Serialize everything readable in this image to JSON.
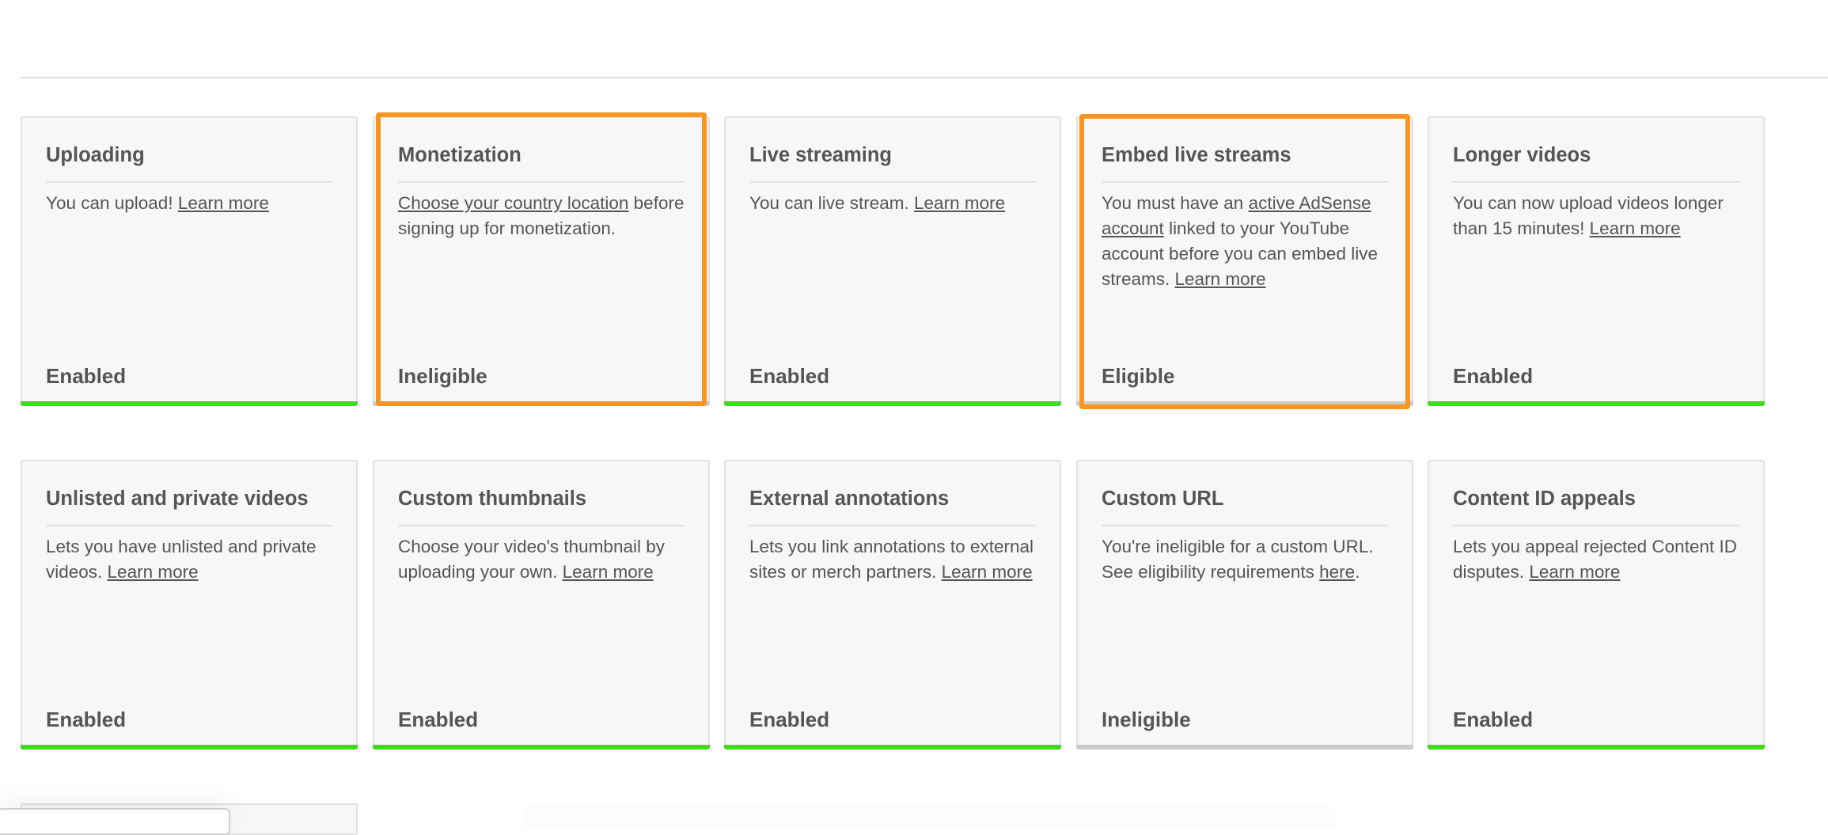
{
  "colors": {
    "enabled_bar": "#41d81d",
    "inactive_bar": "#cccccc",
    "highlight": "#fa9521",
    "card_bg": "#f7f7f7",
    "text": "#555555"
  },
  "features": [
    {
      "title": "Uploading",
      "desc_before": "You can upload! ",
      "link1": "Learn more",
      "desc_middle": "",
      "link2": "",
      "desc_after": "",
      "status": "Enabled",
      "state": "enabled",
      "highlighted": false
    },
    {
      "title": "Monetization",
      "desc_before": "",
      "link1": "Choose your country location",
      "desc_middle": " before signing up for monetization.",
      "link2": "",
      "desc_after": "",
      "status": "Ineligible",
      "state": "inactive",
      "highlighted": true
    },
    {
      "title": "Live streaming",
      "desc_before": "You can live stream. ",
      "link1": "Learn more",
      "desc_middle": "",
      "link2": "",
      "desc_after": "",
      "status": "Enabled",
      "state": "enabled",
      "highlighted": false
    },
    {
      "title": "Embed live streams",
      "desc_before": "You must have an ",
      "link1": "active AdSense account",
      "desc_middle": " linked to your YouTube account before you can embed live streams. ",
      "link2": "Learn more",
      "desc_after": "",
      "status": "Eligible",
      "state": "inactive",
      "highlighted": true
    },
    {
      "title": "Longer videos",
      "desc_before": "You can now upload videos longer than 15 minutes! ",
      "link1": "Learn more",
      "desc_middle": "",
      "link2": "",
      "desc_after": "",
      "status": "Enabled",
      "state": "enabled",
      "highlighted": false
    },
    {
      "title": "Unlisted and private videos",
      "desc_before": "Lets you have unlisted and private videos. ",
      "link1": "Learn more",
      "desc_middle": "",
      "link2": "",
      "desc_after": "",
      "status": "Enabled",
      "state": "enabled",
      "highlighted": false
    },
    {
      "title": "Custom thumbnails",
      "desc_before": "Choose your video's thumbnail by uploading your own. ",
      "link1": "Learn more",
      "desc_middle": "",
      "link2": "",
      "desc_after": "",
      "status": "Enabled",
      "state": "enabled",
      "highlighted": false
    },
    {
      "title": "External annotations",
      "desc_before": "Lets you link annotations to external sites or merch partners. ",
      "link1": "Learn more",
      "desc_middle": "",
      "link2": "",
      "desc_after": "",
      "status": "Enabled",
      "state": "enabled",
      "highlighted": false
    },
    {
      "title": "Custom URL",
      "desc_before": "You're ineligible for a custom URL. See eligibility requirements ",
      "link1": "here",
      "desc_middle": ".",
      "link2": "",
      "desc_after": "",
      "status": "Ineligible",
      "state": "inactive",
      "highlighted": false
    },
    {
      "title": "Content ID appeals",
      "desc_before": "Lets you appeal rejected Content ID disputes. ",
      "link1": "Learn more",
      "desc_middle": "",
      "link2": "",
      "desc_after": "",
      "status": "Enabled",
      "state": "enabled",
      "highlighted": false
    }
  ]
}
